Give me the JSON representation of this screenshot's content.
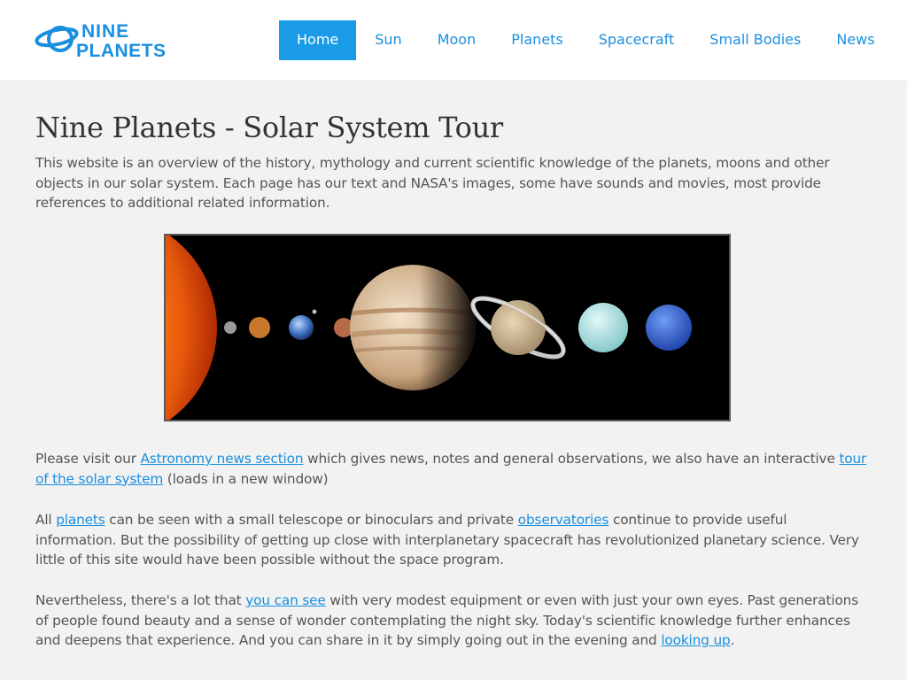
{
  "site": {
    "logo_line1": "NINE",
    "logo_line2": "PLANETS"
  },
  "nav": {
    "items": [
      {
        "label": "Home"
      },
      {
        "label": "Sun"
      },
      {
        "label": "Moon"
      },
      {
        "label": "Planets"
      },
      {
        "label": "Spacecraft"
      },
      {
        "label": "Small Bodies"
      },
      {
        "label": "News"
      }
    ],
    "active": "Home"
  },
  "page": {
    "title": "Nine Planets - Solar System Tour",
    "intro": "This website is an overview of the history, mythology and current scientific knowledge of the planets, moons and other objects in our solar system. Each page has our text and NASA's images, some have sounds and movies, most provide references to additional related information.",
    "p1": {
      "t1": "Please visit our ",
      "link1": "Astronomy news section",
      "t2": " which gives news, notes and general observations, we also have an interactive ",
      "link2": "tour of the solar system",
      "t3": " (loads in a new window)"
    },
    "p2": {
      "t1": "All ",
      "link1": "planets",
      "t2": " can be seen with a small telescope or binoculars and private ",
      "link2": "observatories",
      "t3": " continue to provide useful information. But the possibility of getting up close with interplanetary spacecraft has revolutionized planetary science. Very little of this site would have been possible without the space program."
    },
    "p3": {
      "t1": "Nevertheless, there's a lot that ",
      "link1": "you can see",
      "t2": " with very modest equipment or even with just your own eyes. Past generations of people found beauty and a sense of wonder contemplating the night sky. Today's scientific knowledge further enhances and deepens that experience. And you can share in it by simply going out in the evening and ",
      "link2": "looking up",
      "t3": "."
    }
  },
  "colors": {
    "accent": "#1a9be8",
    "link": "#1a8fe0",
    "background": "#f2f2f2"
  }
}
